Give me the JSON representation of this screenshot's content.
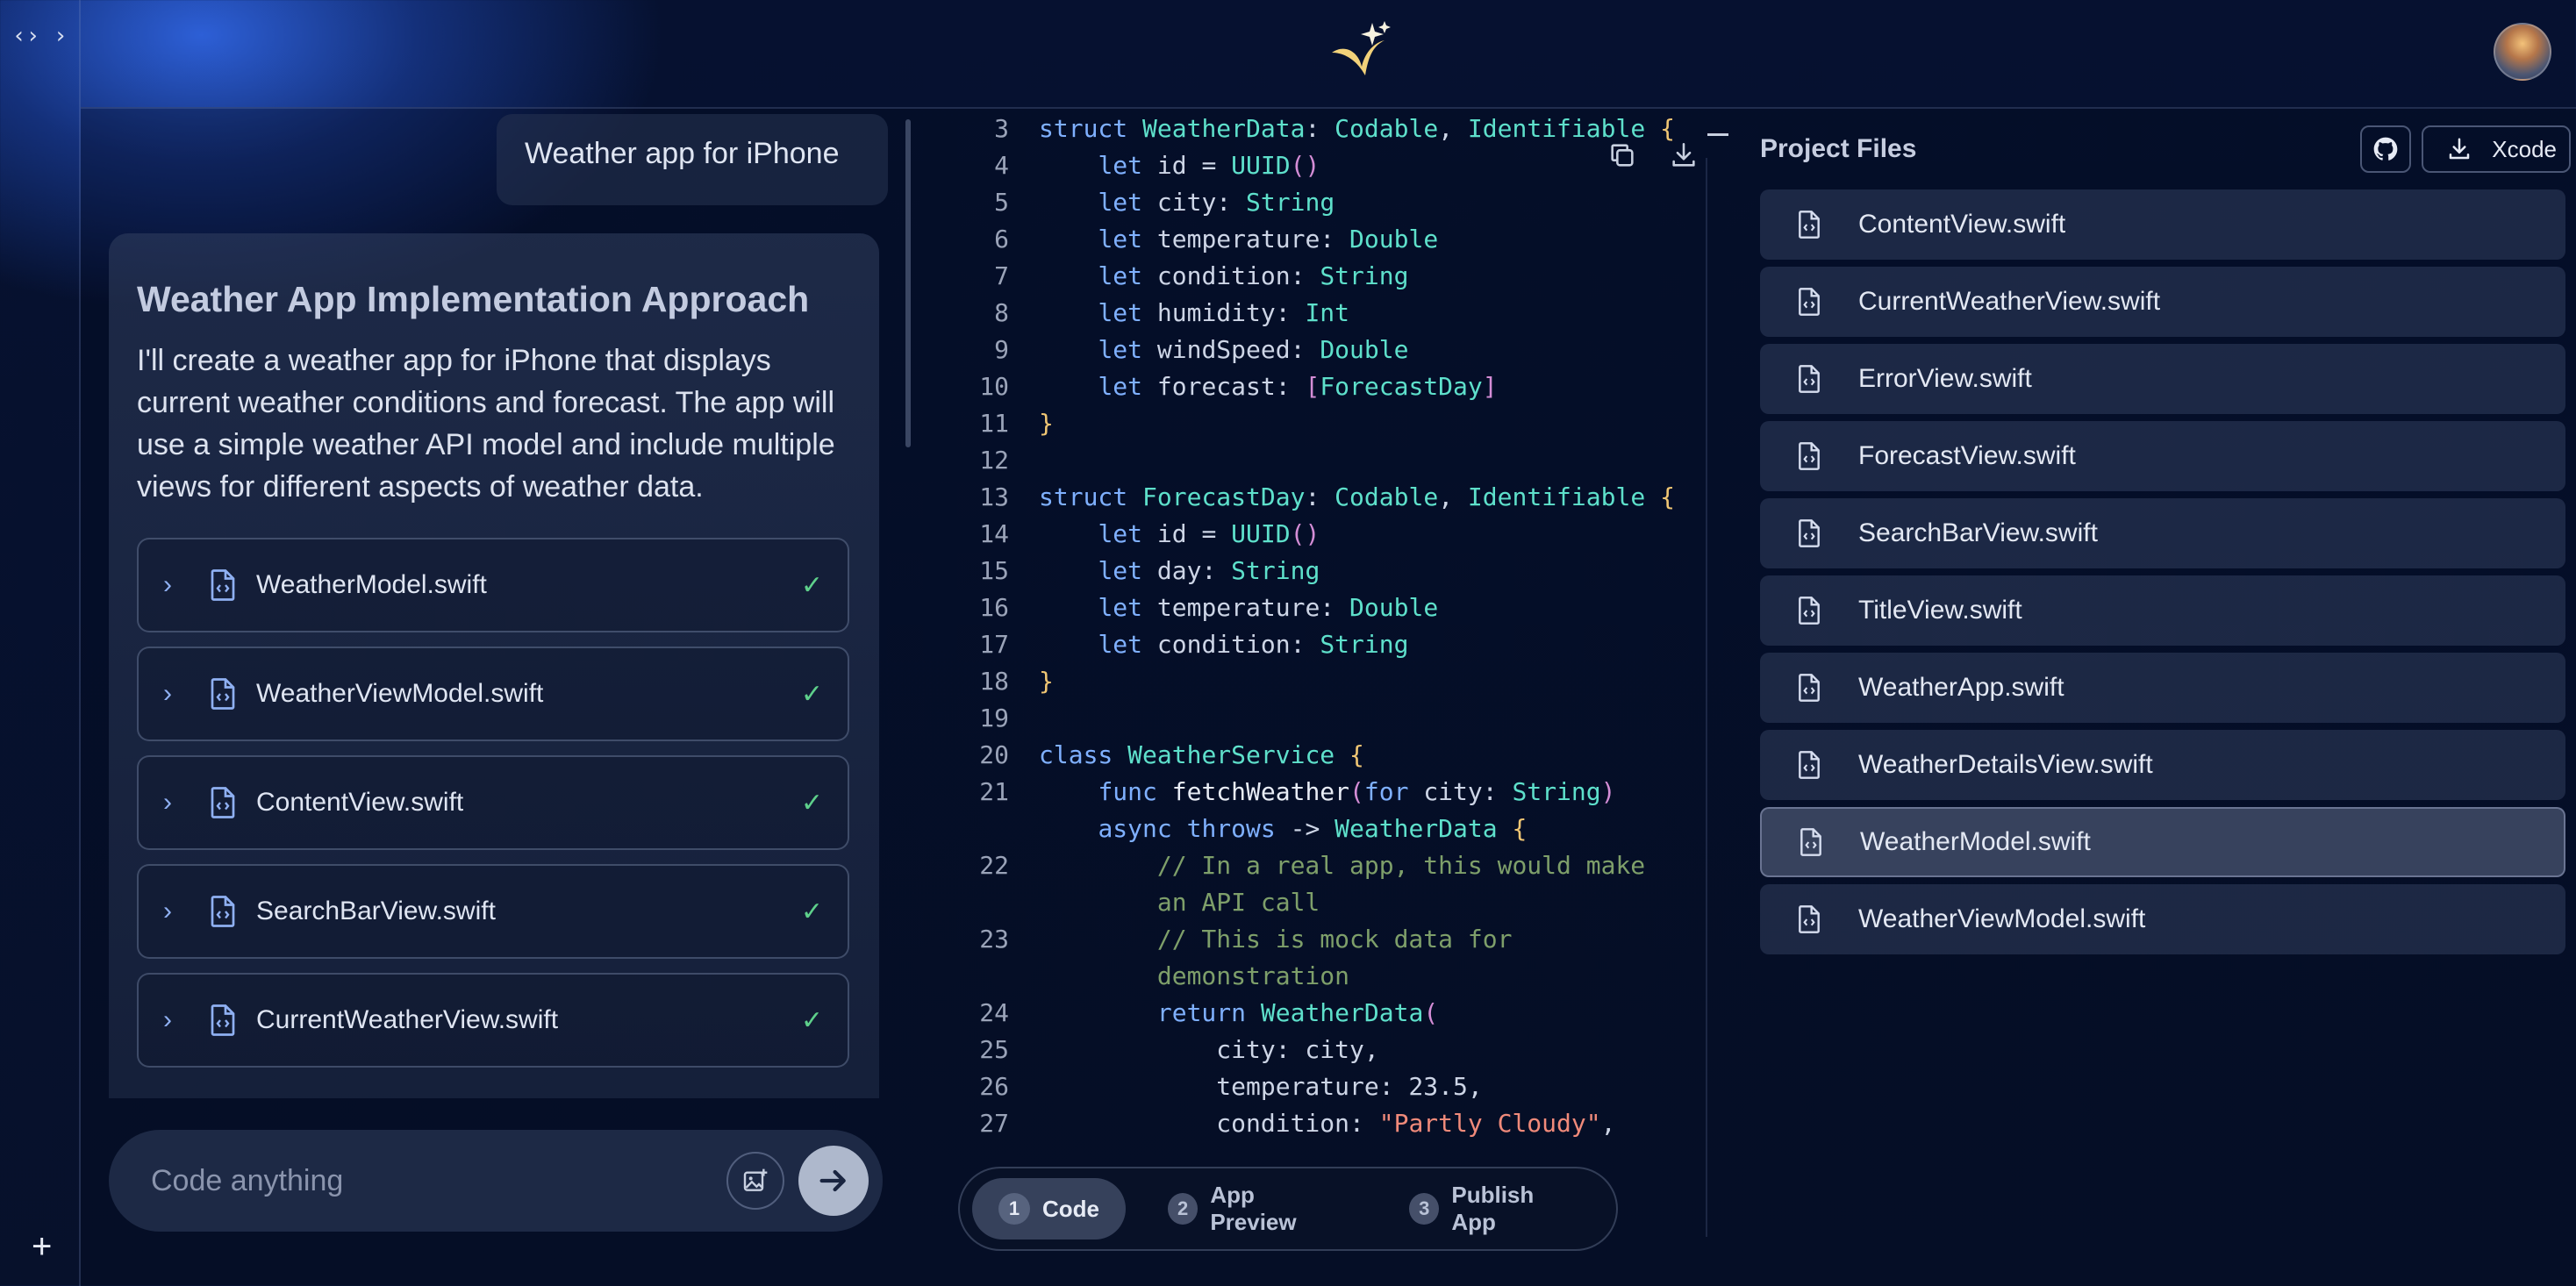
{
  "rail": {
    "toggle_label": "‹› ›",
    "add_label": "+"
  },
  "user_message": "Weather app for iPhone",
  "assistant": {
    "title": "Weather App Implementation Approach",
    "body": "I'll create a weather app for iPhone that displays current weather conditions and forecast. The app will use a simple weather API model and include multiple views for different aspects of weather data.",
    "files": [
      {
        "name": "WeatherModel.swift"
      },
      {
        "name": "WeatherViewModel.swift"
      },
      {
        "name": "ContentView.swift"
      },
      {
        "name": "SearchBarView.swift"
      },
      {
        "name": "CurrentWeatherView.swift"
      }
    ]
  },
  "input": {
    "placeholder": "Code anything"
  },
  "tabs": [
    {
      "num": "1",
      "label": "Code",
      "active": true
    },
    {
      "num": "2",
      "label": "App Preview",
      "active": false
    },
    {
      "num": "3",
      "label": "Publish App",
      "active": false
    }
  ],
  "project_files": {
    "title": "Project Files",
    "xcode_label": "Xcode",
    "files": [
      {
        "name": "ContentView.swift",
        "selected": false
      },
      {
        "name": "CurrentWeatherView.swift",
        "selected": false
      },
      {
        "name": "ErrorView.swift",
        "selected": false
      },
      {
        "name": "ForecastView.swift",
        "selected": false
      },
      {
        "name": "SearchBarView.swift",
        "selected": false
      },
      {
        "name": "TitleView.swift",
        "selected": false
      },
      {
        "name": "WeatherApp.swift",
        "selected": false
      },
      {
        "name": "WeatherDetailsView.swift",
        "selected": false
      },
      {
        "name": "WeatherModel.swift",
        "selected": true
      },
      {
        "name": "WeatherViewModel.swift",
        "selected": false
      }
    ]
  },
  "code": {
    "lines": [
      {
        "n": "3",
        "html": "<span class=\"kw\">struct</span> <span class=\"ty\">WeatherData</span>: <span class=\"ty\">Codable</span>, <span class=\"ty\">Identifiable</span> <span class=\"br\">{</span>"
      },
      {
        "n": "4",
        "html": "    <span class=\"kw\">let</span> id = <span class=\"ty\">UUID</span><span class=\"pn\">()</span>"
      },
      {
        "n": "5",
        "html": "    <span class=\"kw\">let</span> city: <span class=\"ty\">String</span>"
      },
      {
        "n": "6",
        "html": "    <span class=\"kw\">let</span> temperature: <span class=\"ty\">Double</span>"
      },
      {
        "n": "7",
        "html": "    <span class=\"kw\">let</span> condition: <span class=\"ty\">String</span>"
      },
      {
        "n": "8",
        "html": "    <span class=\"kw\">let</span> humidity: <span class=\"ty\">Int</span>"
      },
      {
        "n": "9",
        "html": "    <span class=\"kw\">let</span> windSpeed: <span class=\"ty\">Double</span>"
      },
      {
        "n": "10",
        "html": "    <span class=\"kw\">let</span> forecast: <span class=\"pn\">[</span><span class=\"ty\">ForecastDay</span><span class=\"pn\">]</span>"
      },
      {
        "n": "11",
        "html": "<span class=\"br\">}</span>"
      },
      {
        "n": "12",
        "html": ""
      },
      {
        "n": "13",
        "html": "<span class=\"kw\">struct</span> <span class=\"ty\">ForecastDay</span>: <span class=\"ty\">Codable</span>, <span class=\"ty\">Identifiable</span> <span class=\"br\">{</span>"
      },
      {
        "n": "14",
        "html": "    <span class=\"kw\">let</span> id = <span class=\"ty\">UUID</span><span class=\"pn\">()</span>"
      },
      {
        "n": "15",
        "html": "    <span class=\"kw\">let</span> day: <span class=\"ty\">String</span>"
      },
      {
        "n": "16",
        "html": "    <span class=\"kw\">let</span> temperature: <span class=\"ty\">Double</span>"
      },
      {
        "n": "17",
        "html": "    <span class=\"kw\">let</span> condition: <span class=\"ty\">String</span>"
      },
      {
        "n": "18",
        "html": "<span class=\"br\">}</span>"
      },
      {
        "n": "19",
        "html": ""
      },
      {
        "n": "20",
        "html": "<span class=\"kw\">class</span> <span class=\"ty\">WeatherService</span> <span class=\"br\">{</span>"
      },
      {
        "n": "21",
        "html": "    <span class=\"kw\">func</span> <span class=\"nm\">fetchWeather</span><span class=\"pn\">(</span><span class=\"kw\">for</span> city: <span class=\"ty\">String</span><span class=\"pn\">)</span>"
      },
      {
        "n": "",
        "html": "    <span class=\"kw\">async throws</span> -&gt; <span class=\"ty\">WeatherData</span> <span class=\"br\">{</span>"
      },
      {
        "n": "22",
        "html": "        <span class=\"cm\">// In a real app, this would make</span>"
      },
      {
        "n": "",
        "html": "        <span class=\"cm\">an API call</span>"
      },
      {
        "n": "23",
        "html": "        <span class=\"cm\">// This is mock data for</span>"
      },
      {
        "n": "",
        "html": "        <span class=\"cm\">demonstration</span>"
      },
      {
        "n": "24",
        "html": "        <span class=\"kw\">return</span> <span class=\"ty\">WeatherData</span><span class=\"pn\">(</span>"
      },
      {
        "n": "25",
        "html": "            city: city,"
      },
      {
        "n": "26",
        "html": "            temperature: 23.5,"
      },
      {
        "n": "27",
        "html": "            condition: <span class=\"st\">\"Partly Cloudy\"</span>,"
      }
    ]
  },
  "colors": {
    "accent": "#7fb0ff",
    "check": "#5ed08b",
    "background": "#061130"
  }
}
